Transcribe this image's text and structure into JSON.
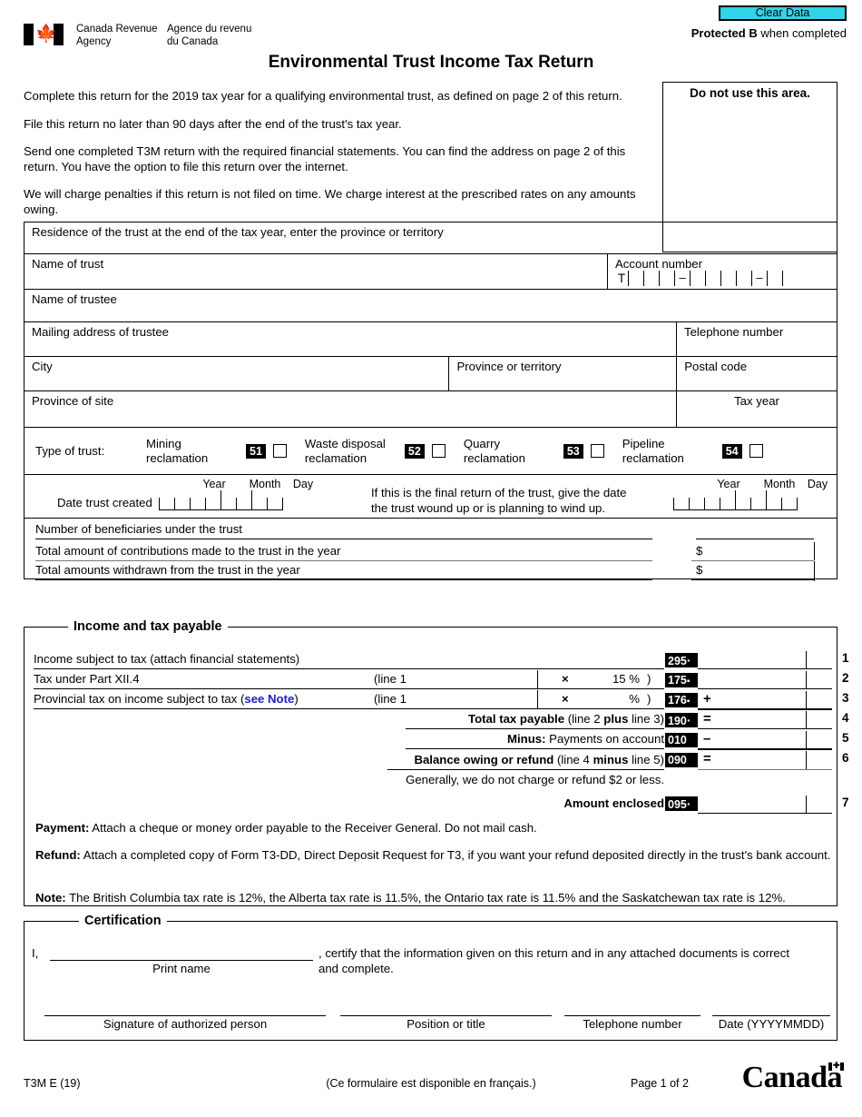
{
  "header": {
    "logo_en": "Canada Revenue\nAgency",
    "logo_fr": "Agence du revenu\ndu Canada",
    "clear_data_label": "Clear Data",
    "protected_bold": "Protected B",
    "protected_rest": " when completed",
    "title": "Environmental Trust Income Tax Return"
  },
  "intro": {
    "p1": "Complete this return for the 2019 tax year for a qualifying environmental trust, as defined on page 2 of this return.",
    "p2": "File this return no later than 90 days after the end of the trust's tax year.",
    "p3": "Send one completed T3M return with the required financial statements. You can find the address on page 2 of this return. You have the option to file this return over the internet.",
    "p4": "We will charge penalties if this return is not filed on time. We charge interest at the prescribed rates on any amounts owing."
  },
  "do_not_use": {
    "label": "Do not use this area."
  },
  "identification": {
    "residence_label": "Residence of the trust at the end of the tax year, enter the province or territory",
    "name_of_trust_label": "Name of trust",
    "account_number_label": "Account number",
    "account_prefix": "T",
    "name_of_trustee_label": "Name of trustee",
    "mailing_address_label": "Mailing address of trustee",
    "telephone_label": "Telephone number",
    "city_label": "City",
    "province_label": "Province or territory",
    "postal_code_label": "Postal code",
    "province_of_site_label": "Province of site",
    "tax_year_label": "Tax year"
  },
  "trust_type": {
    "label": "Type of trust:",
    "options": [
      {
        "name": "Mining\nreclamation",
        "code": "51"
      },
      {
        "name": "Waste disposal\nreclamation",
        "code": "52"
      },
      {
        "name": "Quarry\nreclamation",
        "code": "53"
      },
      {
        "name": "Pipeline\nreclamation",
        "code": "54"
      }
    ]
  },
  "dates": {
    "created_label": "Date trust created",
    "year": "Year",
    "month": "Month",
    "day": "Day",
    "final_return_text": "If this is the final return of the trust, give the date\nthe trust wound up or is planning to wind up."
  },
  "beneficiaries": {
    "line1": "Number of beneficiaries under the trust",
    "line2": "Total amount of contributions made to the trust in the year",
    "line3": "Total amounts withdrawn from the trust in the year",
    "dollar": "$"
  },
  "income_section": {
    "legend": "Income and tax payable",
    "rows": [
      {
        "label": "Income subject to tax (attach financial statements)",
        "code": "295",
        "marker": "·",
        "op": "",
        "no": "1"
      },
      {
        "label": "Tax under Part XII.4",
        "paren": "(line 1",
        "mult": "×",
        "rate": "15 %",
        "close": ")",
        "equals": "=",
        "code": "175",
        "marker": "▪",
        "op": "",
        "no": "2"
      },
      {
        "label_pre": "Provincial tax on income subject to tax (",
        "label_link": "see Note",
        "label_post": ")",
        "paren": "(line 1",
        "mult": "×",
        "rate": "%",
        "close": ")",
        "equals": "=",
        "code": "176",
        "marker": "▪",
        "op": "+",
        "no": "3"
      },
      {
        "label_bold": "Total tax payable",
        "label_rest_a": " (line 2 ",
        "label_bold_b": "plus",
        "label_rest_b": " line 3)",
        "code": "190",
        "marker": "·",
        "op": "=",
        "no": "4"
      },
      {
        "label_bold": "Minus:",
        "label_rest_a": " Payments on account",
        "code": "010",
        "marker": "",
        "op": "–",
        "no": "5"
      },
      {
        "label_bold": "Balance owing or refund",
        "label_rest_a": " (line 4 ",
        "label_bold_b": "minus",
        "label_rest_b": " line 5)",
        "code": "090",
        "marker": "",
        "op": "=",
        "no": "6"
      },
      {
        "label_bold": "Amount enclosed",
        "code": "095",
        "marker": "·",
        "op": "",
        "no": "7"
      }
    ],
    "generally_note": "Generally, we do not charge or refund $2 or less.",
    "payment_bold": "Payment:",
    "payment_text": " Attach a cheque or money order payable to the Receiver General. Do not mail cash.",
    "refund_bold": "Refund:",
    "refund_text": " Attach a completed copy of Form T3-DD, Direct Deposit Request for T3, if you want your refund deposited directly in the trust's bank account.",
    "note_bold": "Note:",
    "note_text": " The British Columbia tax rate is 12%, the Alberta tax rate is 11.5%, the Ontario tax rate is 11.5% and the Saskatchewan tax rate is 12%."
  },
  "certification": {
    "legend": "Certification",
    "i_label": "I,",
    "print_name_caption": "Print name",
    "statement": ", certify that the information given on this return and in any attached documents is correct\nand complete.",
    "signature_caption": "Signature of authorized person",
    "position_caption": "Position or title",
    "telephone_caption": "Telephone number",
    "date_caption": "Date (YYYYMMDD)"
  },
  "footer": {
    "form_code": "T3M E (19)",
    "french_note": "(Ce formulaire est disponible en français.)",
    "page": "Page 1 of 2",
    "wordmark": "Canada"
  },
  "colors": {
    "clear_data_bg": "#30d5e8",
    "link": "#1a1ae0",
    "code_bg": "#000000"
  }
}
